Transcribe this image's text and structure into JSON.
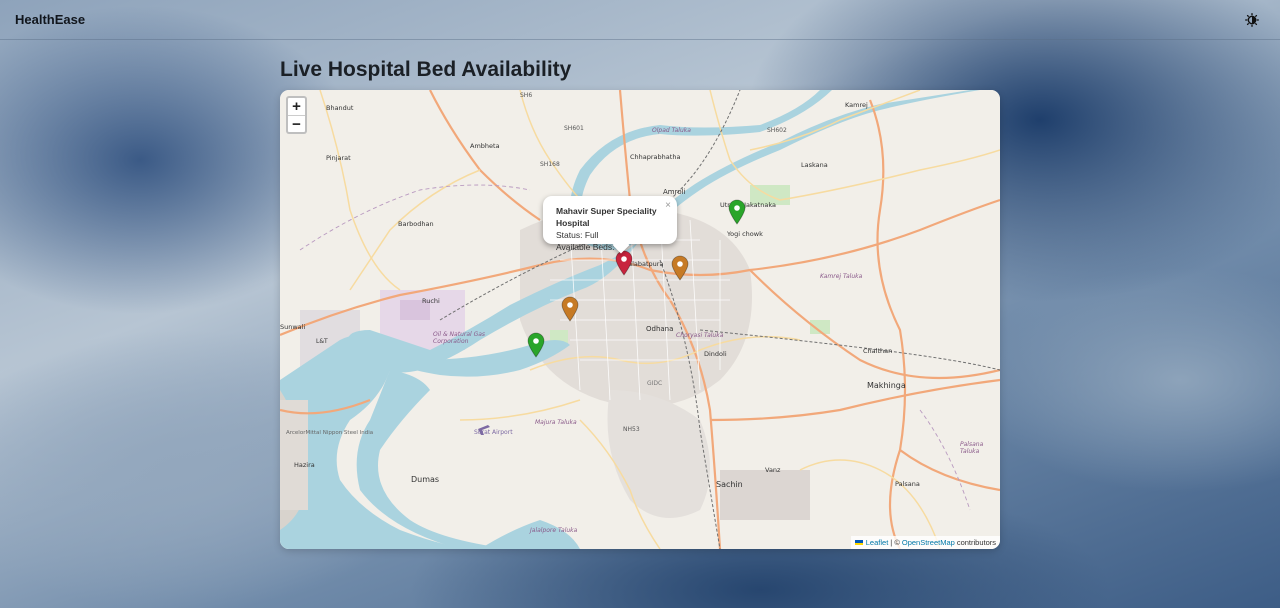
{
  "app": {
    "brand": "HealthEase",
    "theme_icon": "brightness-icon"
  },
  "page": {
    "title": "Live Hospital Bed Availability"
  },
  "map": {
    "zoom_in_label": "+",
    "zoom_out_label": "−",
    "status_colors": {
      "Full": "#c8243e",
      "Limited": "#c67a25",
      "Available": "#2aa52a"
    },
    "markers": [
      {
        "status": "Available",
        "color": "#2aa52a"
      },
      {
        "status": "Full",
        "color": "#c8243e"
      },
      {
        "status": "Limited",
        "color": "#c67a25"
      },
      {
        "status": "Limited",
        "color": "#c67a25"
      },
      {
        "status": "Available",
        "color": "#2aa52a"
      }
    ],
    "popup": {
      "hospital": "Mahavir Super Speciality Hospital",
      "status_line": "Status: Full",
      "beds_line": "Available Beds: 0",
      "close_label": "×"
    },
    "attribution": {
      "leaflet": "Leaflet",
      "separator": "| ©",
      "osm": "OpenStreetMap",
      "suffix": "contributors"
    },
    "labels": [
      "Bhandut",
      "Ambheta",
      "Pinjarat",
      "Barbodhan",
      "Ruchi",
      "Sunwali",
      "L&T",
      "Oil & Natural Gas Corporation",
      "Chhaprabhatha",
      "Amroli",
      "Utrana Jakatnaka",
      "Yogi chowk",
      "Laskana",
      "Kamrej",
      "Salabatpura",
      "Odhana",
      "Dindoli",
      "Chalthan",
      "Makhinga",
      "Kamrej Taluka",
      "Palsana Taluka",
      "Palsana",
      "Surat Airport",
      "Majura Taluka",
      "GIDC",
      "Vanz",
      "Sachin",
      "Dumas",
      "Hazira",
      "ArcelorMittal Nippon Steel India",
      "Olpad Taluka",
      "Choryasi Taluka",
      "Jalalpore Taluka",
      "SH6",
      "SH601",
      "SH168",
      "SH602",
      "NH53"
    ]
  }
}
